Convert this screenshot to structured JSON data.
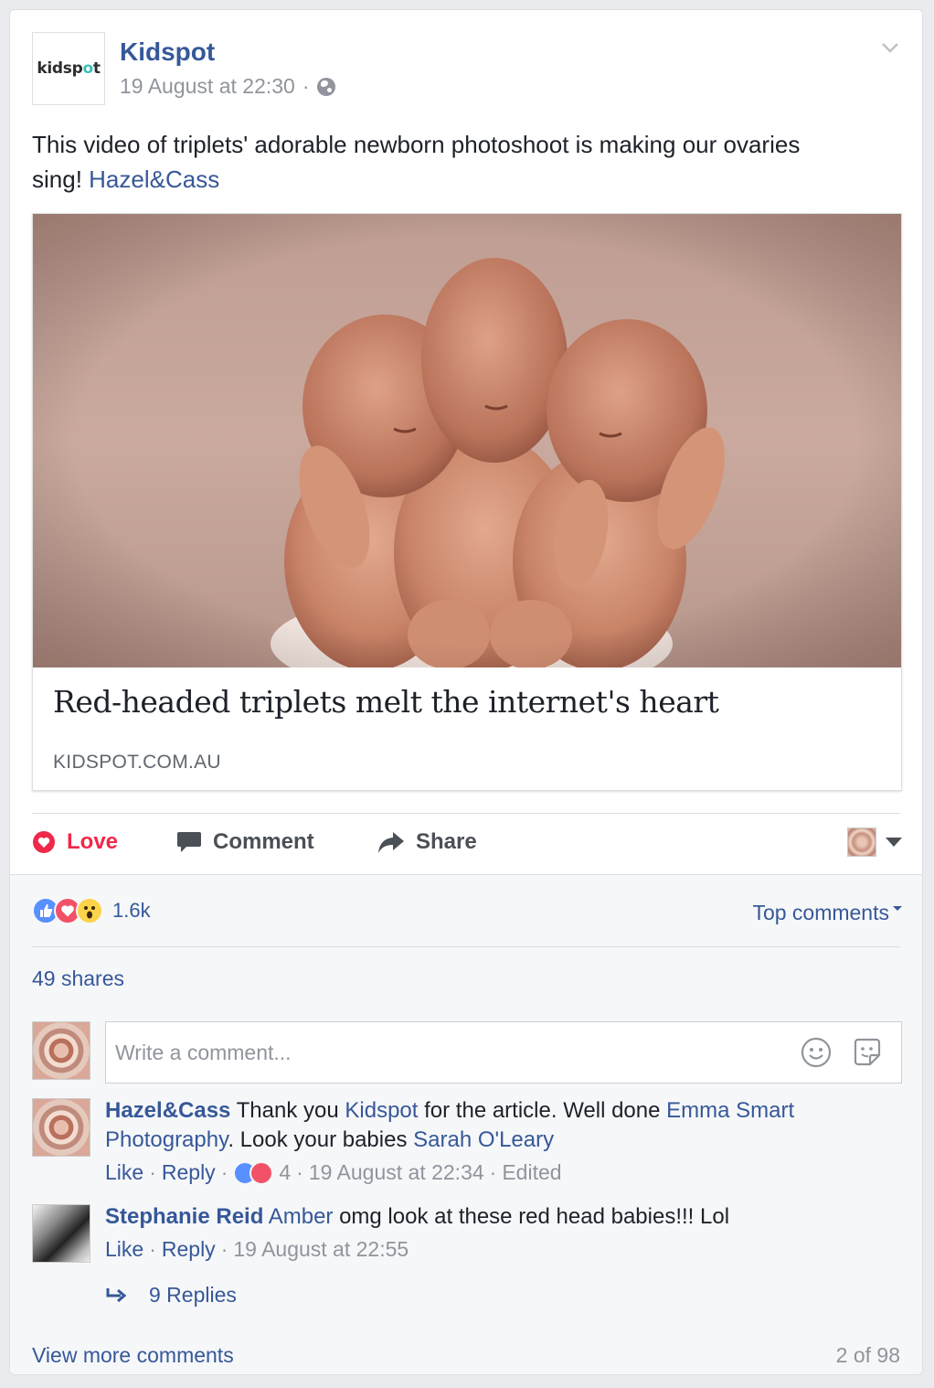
{
  "post": {
    "page_name": "Kidspot",
    "logo_text_a": "kidsp",
    "logo_text_dot": "●",
    "logo_text_b": "t",
    "timestamp": "19 August at 22:30",
    "meta_sep": "·",
    "text": "This video of triplets' adorable newborn photoshoot is making our ovaries sing!",
    "text_mention": "Hazel&Cass"
  },
  "preview": {
    "title": "Red-headed triplets melt the internet's heart",
    "domain": "KIDSPOT.COM.AU"
  },
  "actions": {
    "love": "Love",
    "comment": "Comment",
    "share": "Share"
  },
  "stats": {
    "reaction_count": "1.6k",
    "top_comments": "Top comments",
    "shares": "49 shares"
  },
  "composer": {
    "placeholder": "Write a comment..."
  },
  "comments": [
    {
      "author": "Hazel&Cass",
      "text_1": "Thank you",
      "mention_1": "Kidspot",
      "text_2": "for the article. Well done",
      "mention_2": "Emma Smart Photography",
      "text_3": ". Look your babies",
      "mention_3": "Sarah O'Leary",
      "like": "Like",
      "reply": "Reply",
      "reaction_count": "4",
      "time": "19 August at 22:34",
      "edited": "Edited"
    },
    {
      "author": "Stephanie Reid",
      "mention_1": "Amber",
      "text_1": "omg look at these red head babies!!! Lol",
      "like": "Like",
      "reply": "Reply",
      "time": "19 August at 22:55"
    }
  ],
  "replies_label": "9 Replies",
  "view_more": "View more comments",
  "count_of": "2 of 98",
  "colors": {
    "link_blue": "#365899",
    "love_red": "#f0284a",
    "meta_grey": "#90949c",
    "section_grey": "#f6f7f9"
  },
  "icons": [
    "chevron-down-icon",
    "globe-icon",
    "heart-outline-icon",
    "comment-bubble-icon",
    "share-arrow-icon",
    "like-reaction-icon",
    "love-reaction-icon",
    "wow-reaction-icon",
    "smiley-icon",
    "sticker-icon",
    "reply-arrow-icon"
  ]
}
